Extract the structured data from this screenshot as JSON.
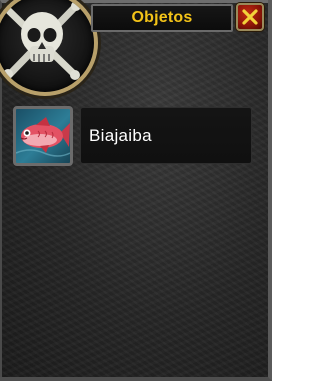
{
  "window": {
    "title": "Objetos",
    "close_icon": "close-x-icon",
    "portrait_icon": "skull-crossbones-icon"
  },
  "loot": {
    "items": [
      {
        "name": "Biajaiba",
        "icon": "red-fish-icon"
      }
    ]
  },
  "colors": {
    "title": "#f3c318",
    "item_name": "#ffffff",
    "close_button": "#a11c0a",
    "frame": "#262626"
  }
}
